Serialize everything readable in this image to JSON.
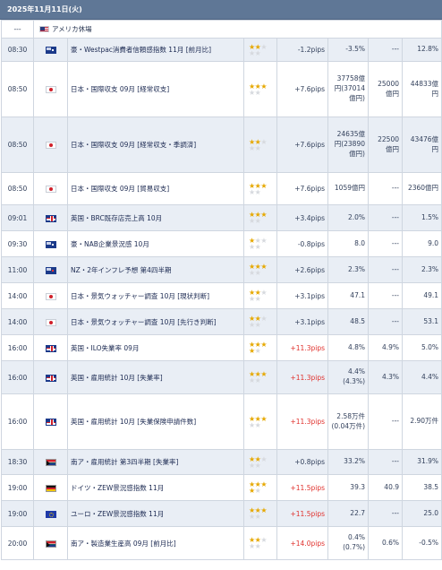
{
  "header": {
    "date": "2025年11月11日(火)"
  },
  "holiday": {
    "time": "---",
    "text": "アメリカ休場"
  },
  "colors": {
    "header_bg": "#5f7796",
    "row_alt": "#e9eef5",
    "star_on": "#e6a800",
    "star_off": "#d6d9de",
    "pips_up_color": "#e0312d"
  },
  "rows": [
    {
      "time": "08:30",
      "flag": "au",
      "flag_icon": "australia-flag-icon",
      "name": "豪・Westpac消費者信頼感指数 11月 [前月比]",
      "stars": 2,
      "pips": "-1.2pips",
      "pips_red": false,
      "prev": "-3.5%",
      "forecast": "---",
      "actual": "12.8%",
      "h": 26
    },
    {
      "time": "08:50",
      "flag": "jp",
      "flag_icon": "japan-flag-icon",
      "name": "日本・国際収支 09月 [経常収支]",
      "stars": 3,
      "pips": "+7.6pips",
      "pips_red": false,
      "prev": "37758億円(37014億円)",
      "forecast": "25000億円",
      "actual": "44833億円",
      "h": 62
    },
    {
      "time": "08:50",
      "flag": "jp",
      "flag_icon": "japan-flag-icon",
      "name": "日本・国際収支 09月 [経常収支・季調済]",
      "stars": 2,
      "pips": "+7.6pips",
      "pips_red": false,
      "prev": "24635億円(23890億円)",
      "forecast": "22500億円",
      "actual": "43476億円",
      "h": 62
    },
    {
      "time": "08:50",
      "flag": "jp",
      "flag_icon": "japan-flag-icon",
      "name": "日本・国際収支 09月 [貿易収支]",
      "stars": 3,
      "pips": "+7.6pips",
      "pips_red": false,
      "prev": "1059億円",
      "forecast": "---",
      "actual": "2360億円",
      "h": 36
    },
    {
      "time": "09:01",
      "flag": "gb",
      "flag_icon": "uk-flag-icon",
      "name": "英国・BRC既存店売上高 10月",
      "stars": 3,
      "pips": "+3.4pips",
      "pips_red": false,
      "prev": "2.0%",
      "forecast": "---",
      "actual": "1.5%",
      "h": 29
    },
    {
      "time": "09:30",
      "flag": "au",
      "flag_icon": "australia-flag-icon",
      "name": "豪・NAB企業景況感 10月",
      "stars": 1,
      "pips": "-0.8pips",
      "pips_red": false,
      "prev": "8.0",
      "forecast": "---",
      "actual": "9.0",
      "h": 29
    },
    {
      "time": "11:00",
      "flag": "nz",
      "flag_icon": "new-zealand-flag-icon",
      "name": "NZ・2年インフレ予想 第4四半期",
      "stars": 3,
      "pips": "+2.6pips",
      "pips_red": false,
      "prev": "2.3%",
      "forecast": "---",
      "actual": "2.3%",
      "h": 29
    },
    {
      "time": "14:00",
      "flag": "jp",
      "flag_icon": "japan-flag-icon",
      "name": "日本・景気ウォッチャー調査 10月 [現状判断]",
      "stars": 2,
      "pips": "+3.1pips",
      "pips_red": false,
      "prev": "47.1",
      "forecast": "---",
      "actual": "49.1",
      "h": 29
    },
    {
      "time": "14:00",
      "flag": "jp",
      "flag_icon": "japan-flag-icon",
      "name": "日本・景気ウォッチャー調査 10月 [先行き判断]",
      "stars": 2,
      "pips": "+3.1pips",
      "pips_red": false,
      "prev": "48.5",
      "forecast": "---",
      "actual": "53.1",
      "h": 29
    },
    {
      "time": "16:00",
      "flag": "gb",
      "flag_icon": "uk-flag-icon",
      "name": "英国・ILO失業率 09月",
      "stars": 4,
      "pips": "+11.3pips",
      "pips_red": true,
      "prev": "4.8%",
      "forecast": "4.9%",
      "actual": "5.0%",
      "h": 29
    },
    {
      "time": "16:00",
      "flag": "gb",
      "flag_icon": "uk-flag-icon",
      "name": "英国・雇用統計 10月 [失業率]",
      "stars": 3,
      "pips": "+11.3pips",
      "pips_red": true,
      "prev": "4.4%(4.3%)",
      "forecast": "4.3%",
      "actual": "4.4%",
      "h": 37
    },
    {
      "time": "16:00",
      "flag": "gb",
      "flag_icon": "uk-flag-icon",
      "name": "英国・雇用統計 10月 [失業保険申請件数]",
      "stars": 3,
      "pips": "+11.3pips",
      "pips_red": true,
      "prev": "2.58万件(0.04万件)",
      "forecast": "---",
      "actual": "2.90万件",
      "h": 62
    },
    {
      "time": "18:30",
      "flag": "za",
      "flag_icon": "south-africa-flag-icon",
      "name": "南ア・雇用統計 第3四半期 [失業率]",
      "stars": 2,
      "pips": "+0.8pips",
      "pips_red": false,
      "prev": "33.2%",
      "forecast": "---",
      "actual": "31.9%",
      "h": 28
    },
    {
      "time": "19:00",
      "flag": "de",
      "flag_icon": "germany-flag-icon",
      "name": "ドイツ・ZEW景況感指数 11月",
      "stars": 4,
      "pips": "+11.5pips",
      "pips_red": true,
      "prev": "39.3",
      "forecast": "40.9",
      "actual": "38.5",
      "h": 29
    },
    {
      "time": "19:00",
      "flag": "eu",
      "flag_icon": "eu-flag-icon",
      "name": "ユーロ・ZEW景況感指数 11月",
      "stars": 3,
      "pips": "+11.5pips",
      "pips_red": true,
      "prev": "22.7",
      "forecast": "---",
      "actual": "25.0",
      "h": 29
    },
    {
      "time": "20:00",
      "flag": "za",
      "flag_icon": "south-africa-flag-icon",
      "name": "南ア・製造業生産高 09月 [前月比]",
      "stars": 2,
      "pips": "+14.0pips",
      "pips_red": true,
      "prev": "0.4%(0.7%)",
      "forecast": "0.6%",
      "actual": "-0.5%",
      "h": 37
    }
  ]
}
